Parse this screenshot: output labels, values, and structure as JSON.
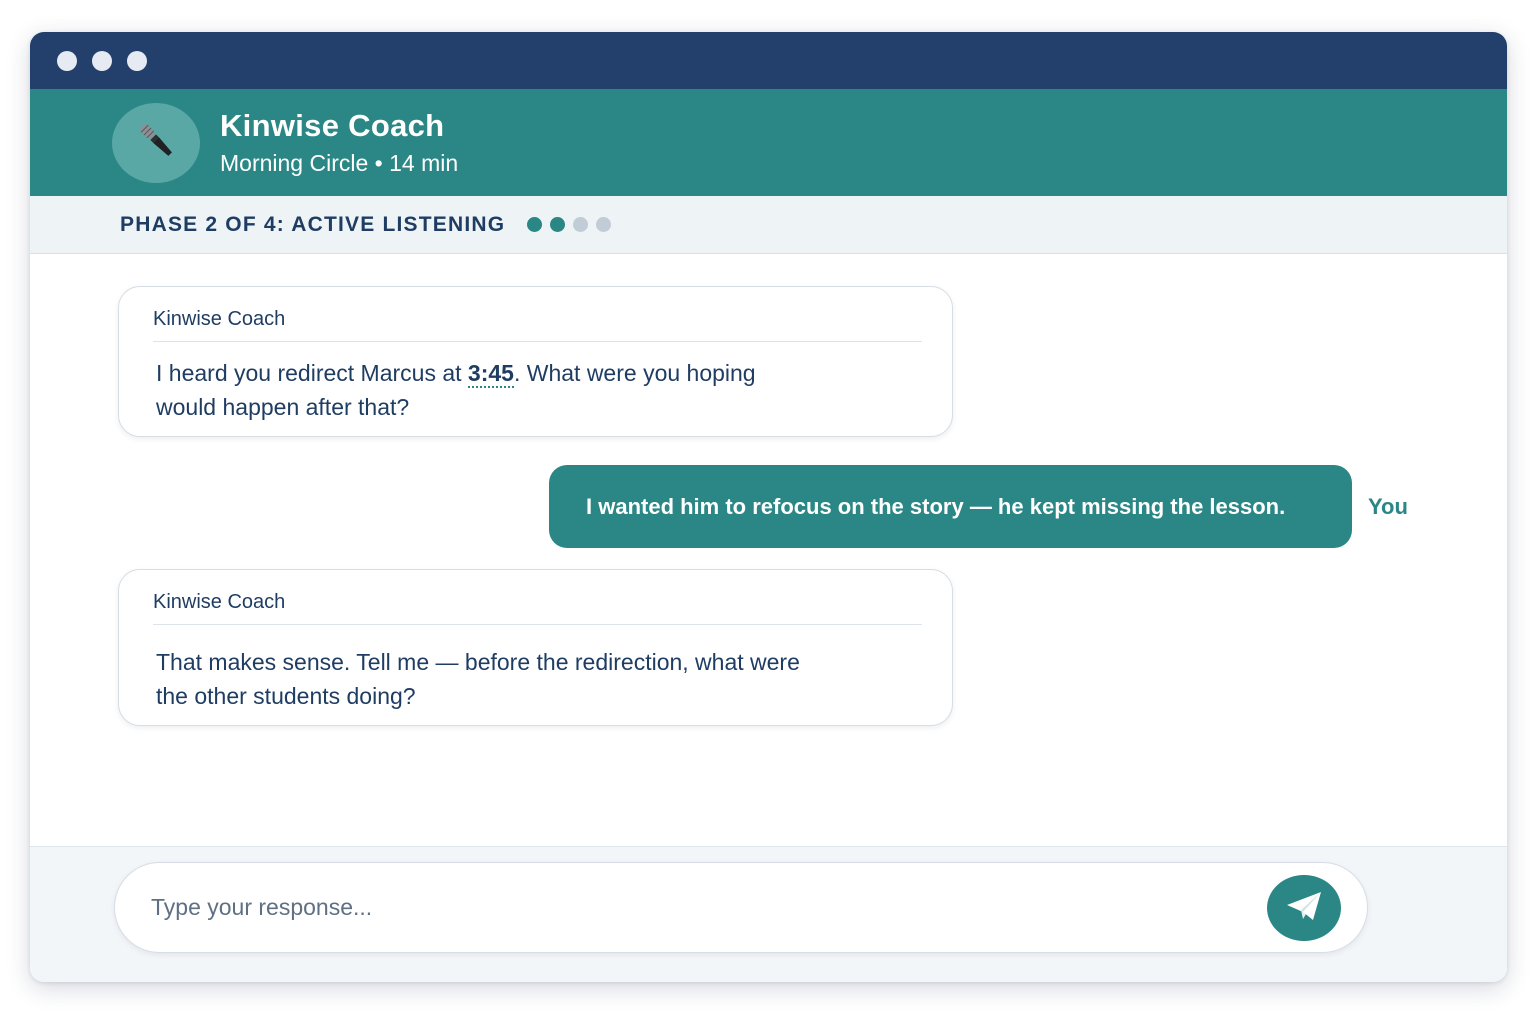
{
  "window": {
    "controls": [
      "close",
      "minimize",
      "maximize"
    ]
  },
  "header": {
    "avatar_icon": "microphone-icon",
    "title": "Kinwise Coach",
    "subtitle": "Morning Circle • 14 min"
  },
  "phase": {
    "label": "PHASE 2 OF 4: ACTIVE LISTENING",
    "current": 2,
    "total": 4
  },
  "messages": [
    {
      "author": "Kinwise Coach",
      "text_before": "I heard you redirect Marcus at ",
      "timestamp": "3:45",
      "text_after": ". What were you hoping would happen after that?"
    },
    {
      "author": "You",
      "text": "I wanted him to refocus on the story — he kept missing the lesson."
    },
    {
      "author": "Kinwise Coach",
      "text": "That makes sense. Tell me — before the redirection, what were the other students doing?"
    }
  ],
  "composer": {
    "placeholder": "Type your response...",
    "send_icon": "paper-plane-icon"
  },
  "colors": {
    "titlebar": "#233f6b",
    "accent": "#2a8785",
    "text": "#1f3d63",
    "inactive_dot": "#c1ccd6"
  }
}
